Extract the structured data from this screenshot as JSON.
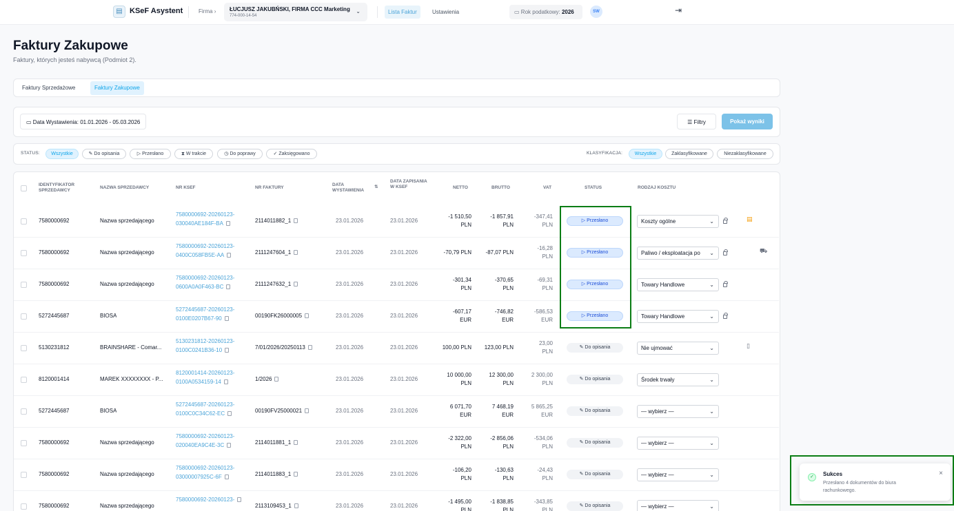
{
  "header": {
    "app_title": "KSeF Asystent",
    "firm_label": "Firma",
    "firm_name": "ŁUCJUSZ JAKUBŃSKI, FIRMA CCC Marketing",
    "firm_nip": "774-000-14-54",
    "nav_invoices": "Lista Faktur",
    "nav_settings": "Ustawienia",
    "tax_year_label": "Rok podatkowy:",
    "tax_year": "2026",
    "avatar": "SW"
  },
  "page": {
    "title": "Faktury Zakupowe",
    "subtitle": "Faktury, których jesteś nabywcą (Podmiot 2).",
    "tabs": [
      "Faktury Sprzedażowe",
      "Faktury Zakupowe"
    ]
  },
  "filters": {
    "date": "Data Wystawienia: 01.01.2026 - 05.03.2026",
    "filters_button": "Filtry",
    "show_button": "Pokaż wyniki",
    "status_label": "STATUS:",
    "status_chips": [
      "Wszystkie",
      "Do opisania",
      "Przesłano",
      "W trakcie",
      "Do poprawy",
      "Zaksięgowano"
    ],
    "classification_label": "KLASYFIKACJA:",
    "classification_chips": [
      "Wszystkie",
      "Zaklasyfikowane",
      "Niezaklasyfikowane"
    ]
  },
  "table": {
    "headers": [
      "IDENTYFIKATOR SPRZEDAWCY",
      "NAZWA SPRZEDAWCY",
      "NR KSEF",
      "NR FAKTURY",
      "DATA WYSTAWIENIA",
      "DATA ZAPISANIA W KSEF",
      "NETTO",
      "BRUTTO",
      "VAT",
      "STATUS",
      "RODZAJ KOSZTU"
    ],
    "rows": [
      {
        "id": "7580000692",
        "name": "Nazwa sprzedającego",
        "ksef": "7580000692-20260123-030040AE184F-BA",
        "nr": "2114011882_1",
        "issued": "23.01.2026",
        "saved": "23.01.2026",
        "netto": "-1 510,50 PLN",
        "brutto": "-1 857,91 PLN",
        "vat": "-347,41 PLN",
        "status": "Przesłano",
        "cost": "Koszty ogólne"
      },
      {
        "id": "7580000692",
        "name": "Nazwa sprzedającego",
        "ksef": "7580000692-20260123-0400C058FB5E-AA",
        "nr": "2111247604_1",
        "issued": "23.01.2026",
        "saved": "23.01.2026",
        "netto": "-70,79 PLN",
        "brutto": "-87,07 PLN",
        "vat": "-16,28 PLN",
        "status": "Przesłano",
        "cost": "Paliwo / eksploatacja po"
      },
      {
        "id": "7580000692",
        "name": "Nazwa sprzedającego",
        "ksef": "7580000692-20260123-0600A0A0F463-BC",
        "nr": "2111247632_1",
        "issued": "23.01.2026",
        "saved": "23.01.2026",
        "netto": "-301,34 PLN",
        "brutto": "-370,65 PLN",
        "vat": "-69,31 PLN",
        "status": "Przesłano",
        "cost": "Towary Handlowe"
      },
      {
        "id": "5272445687",
        "name": "BIOSA",
        "ksef": "5272445687-20260123-0100E0207B67-90",
        "nr": "00190FK26000005",
        "issued": "23.01.2026",
        "saved": "23.01.2026",
        "netto": "-607,17 EUR",
        "brutto": "-746,82 EUR",
        "vat": "-586,53 EUR",
        "status": "Przesłano",
        "cost": "Towary Handlowe"
      },
      {
        "id": "5130231812",
        "name": "BRAINSHARE - Comar...",
        "ksef": "5130231812-20260123-0100C0241B36-10",
        "nr": "7/01/2026/20250113",
        "issued": "23.01.2026",
        "saved": "23.01.2026",
        "netto": "100,00 PLN",
        "brutto": "123,00 PLN",
        "vat": "23,00 PLN",
        "status": "Do opisania",
        "cost": "Nie ujmować"
      },
      {
        "id": "8120001414",
        "name": "MAREK XXXXXXXX - P...",
        "ksef": "8120001414-20260123-0100A0534159-14",
        "nr": "1/2026",
        "issued": "23.01.2026",
        "saved": "23.01.2026",
        "netto": "10 000,00 PLN",
        "brutto": "12 300,00 PLN",
        "vat": "2 300,00 PLN",
        "status": "Do opisania",
        "cost": "Środek trwały"
      },
      {
        "id": "5272445687",
        "name": "BIOSA",
        "ksef": "5272445687-20260123-0100C0C34C62-EC",
        "nr": "00190FV25000021",
        "issued": "23.01.2026",
        "saved": "23.01.2026",
        "netto": "6 071,70 EUR",
        "brutto": "7 468,19 EUR",
        "vat": "5 865,25 EUR",
        "status": "Do opisania",
        "cost": "— wybierz —"
      },
      {
        "id": "7580000692",
        "name": "Nazwa sprzedającego",
        "ksef": "7580000692-20260123-020040EA9C4E-3C",
        "nr": "2114011881_1",
        "issued": "23.01.2026",
        "saved": "23.01.2026",
        "netto": "-2 322,00 PLN",
        "brutto": "-2 856,06 PLN",
        "vat": "-534,06 PLN",
        "status": "Do opisania",
        "cost": "— wybierz —"
      },
      {
        "id": "7580000692",
        "name": "Nazwa sprzedającego",
        "ksef": "7580000692-20260123-03000007925C-6F",
        "nr": "2114011883_1",
        "issued": "23.01.2026",
        "saved": "23.01.2026",
        "netto": "-106,20 PLN",
        "brutto": "-130,63 PLN",
        "vat": "-24,43 PLN",
        "status": "Do opisania",
        "cost": "— wybierz —"
      },
      {
        "id": "7580000692",
        "name": "Nazwa sprzedającego",
        "ksef": "7580000692-20260123-",
        "nr": "2113109453_1",
        "issued": "23.01.2026",
        "saved": "23.01.2026",
        "netto": "-1 495,00 PLN",
        "brutto": "-1 838,85 PLN",
        "vat": "-343,85 PLN",
        "status": "Do opisania",
        "cost": "— wybierz —"
      }
    ]
  },
  "toast": {
    "title": "Sukces",
    "message": "Przesłano 4 dokumentów do biura rachunkowego."
  },
  "colors": {
    "accent": "#4aa3d8",
    "highlight": "#0a7d14",
    "sent_pill": "#dbeafe"
  }
}
